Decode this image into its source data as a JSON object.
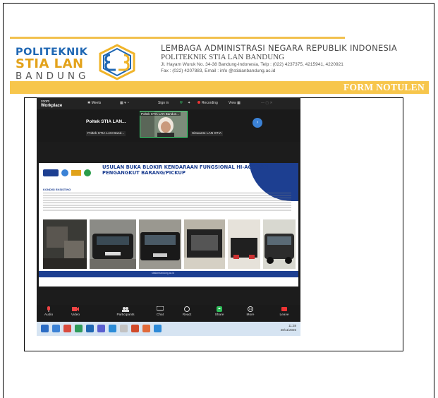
{
  "letterhead": {
    "logo_line1": "POLITEKNIK",
    "logo_line2": "STIA LAN",
    "logo_line3": "BANDUNG",
    "org_line1": "LEMBAGA ADMINISTRASI NEGARA REPUBLIK INDONESIA",
    "org_line2": "POLITEKNIK STIA LAN BANDUNG",
    "address": "Jl. Hayam Wuruk No. 34-38 Bandung-Indonesia, Telp : (022) 4237375, 4215941, 4220921",
    "contact": "Fax : (022) 4207883, Email : info @stialanbandung.ac.id",
    "form_label": "FORM NOTULEN"
  },
  "zoom": {
    "brand_top": "zoom",
    "brand_bottom": "Workplace",
    "meets": "Meets",
    "sign_in": "Sign in",
    "recording": "Recording",
    "view": "View",
    "gallery_label": "Poltek STIA LAN...",
    "tile_name_1": "Poltek STIA LAN Band...",
    "tile_name_2": "Poltek STIA LAN Bandun...",
    "tile_name_3": "Siswanto LAN STIA",
    "controls": [
      {
        "label": "Audio",
        "icon": "mic-icon"
      },
      {
        "label": "Video",
        "icon": "camera-icon"
      },
      {
        "label": "Participants",
        "icon": "participants-icon"
      },
      {
        "label": "Chat",
        "icon": "chat-icon"
      },
      {
        "label": "React",
        "icon": "react-icon"
      },
      {
        "label": "Share",
        "icon": "share-icon"
      },
      {
        "label": "More",
        "icon": "more-icon"
      },
      {
        "label": "Leave",
        "icon": "leave-icon"
      }
    ],
    "participants_count": "13",
    "clock_time": "11:38",
    "clock_date": "28/11/2025"
  },
  "slide": {
    "title": "USULAN BUKA BLOKIR KENDARAAN FUNGSIONAL HI-ACE DAN PENGANGKUT BARANG/PICKUP",
    "section": "KONDISI EKSISTING",
    "footer": "stialanbandung.ac.id"
  },
  "colors": {
    "accent_yellow": "#f7c64c",
    "brand_blue": "#1d3f91",
    "zoom_dark": "#1c1c1c"
  }
}
